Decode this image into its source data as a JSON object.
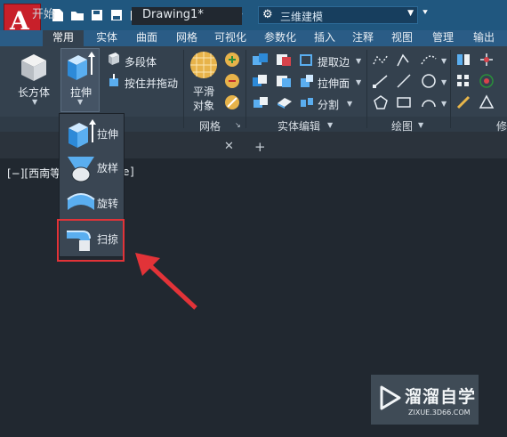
{
  "app": {
    "logo_letter": "A"
  },
  "workspace": {
    "selected": "三维建模"
  },
  "ribbon_tabs": [
    "常用",
    "实体",
    "曲面",
    "网格",
    "可视化",
    "参数化",
    "插入",
    "注释",
    "视图",
    "管理",
    "输出"
  ],
  "active_tab": "常用",
  "modeling": {
    "box_label": "长方体",
    "extrude_label": "拉伸",
    "polysolid_label": "多段体",
    "presspull_label": "按住并拖动"
  },
  "mesh": {
    "smooth_label": "平滑\n对象",
    "smooth_line1": "平滑",
    "smooth_line2": "对象",
    "panel_title": "网格"
  },
  "solid_edit": {
    "extract_edges": "提取边",
    "extrude_faces": "拉伸面",
    "separate": "分割",
    "panel_title": "实体编辑"
  },
  "draw": {
    "panel_title": "绘图"
  },
  "modify_partial": "修",
  "doc_tabs": {
    "start": "开始",
    "drawing": "Drawing1*"
  },
  "viewport_label": "[−][西南等",
  "viewport_label_end": "]",
  "viewport_label_mid": "e",
  "dropdown_items": [
    "拉伸",
    "放样",
    "旋转",
    "扫掠"
  ],
  "watermark": {
    "title": "溜溜自学",
    "url": "ZIXUE.3D66.COM"
  }
}
